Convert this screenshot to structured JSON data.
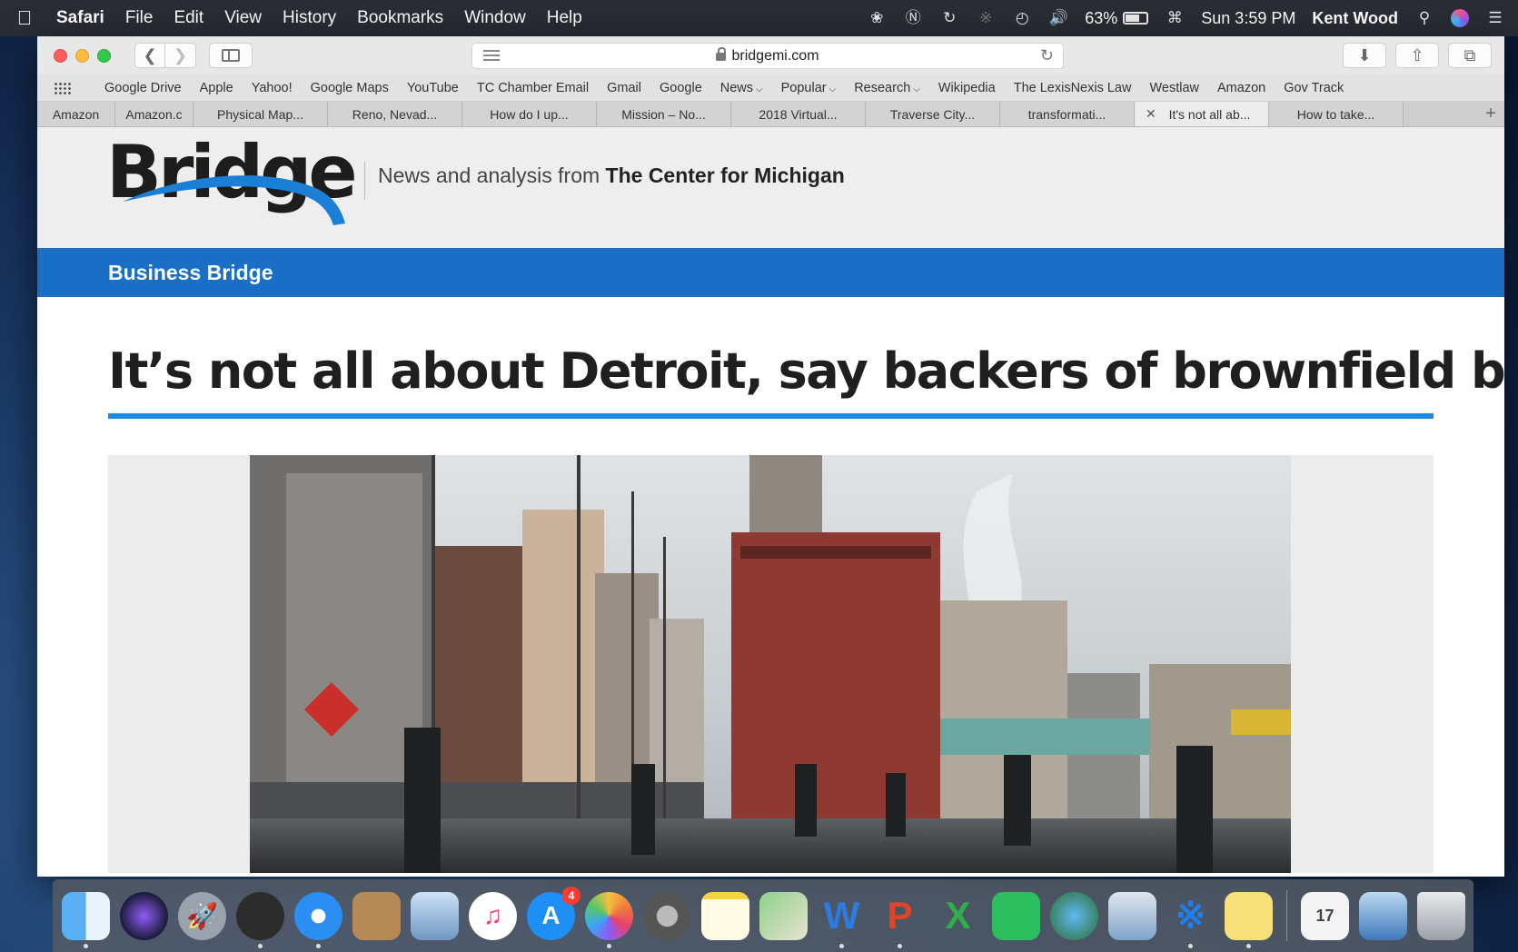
{
  "menubar": {
    "app": "Safari",
    "items": [
      "File",
      "Edit",
      "View",
      "History",
      "Bookmarks",
      "Window",
      "Help"
    ],
    "battery": "63%",
    "clock": "Sun 3:59 PM",
    "user": "Kent Wood"
  },
  "browser": {
    "url": "bridgemi.com",
    "bookmarks": [
      "Google Drive",
      "Apple",
      "Yahoo!",
      "Google Maps",
      "YouTube",
      "TC Chamber Email",
      "Gmail",
      "Google",
      "News",
      "Popular",
      "Research",
      "Wikipedia",
      "The LexisNexis Law",
      "Westlaw",
      "Amazon",
      "Gov Track"
    ],
    "tabs": [
      "Amazon",
      "Amazon.c",
      "Physical Map...",
      "Reno, Nevad...",
      "How do I up...",
      "Mission – No...",
      "2018 Virtual...",
      "Traverse City...",
      "transformati...",
      "It's not all ab...",
      "How to take..."
    ]
  },
  "site": {
    "logo": "Bridge",
    "tagline_prefix": "News and analysis from",
    "tagline_strong": "The Center for Michigan",
    "section": "Business Bridge",
    "headline": "It’s not all about Detroit, say backers of brownfield bill"
  },
  "colors": {
    "section_blue": "#1a6fc4",
    "rule_blue": "#1a8ae4",
    "swoosh_blue": "#1c7fd6"
  },
  "dock": {
    "apps": [
      "finder",
      "siri",
      "launchpad",
      "dashboard",
      "safari",
      "contacts",
      "preview",
      "itunes",
      "app-store",
      "photos",
      "system-preferences",
      "notes",
      "maps",
      "word",
      "powerpoint",
      "excel",
      "evernote",
      "vpn",
      "network",
      "bluetooth",
      "stickies",
      "calendar-file",
      "screen-sharing",
      "trash"
    ],
    "app_store_badge": "4"
  }
}
